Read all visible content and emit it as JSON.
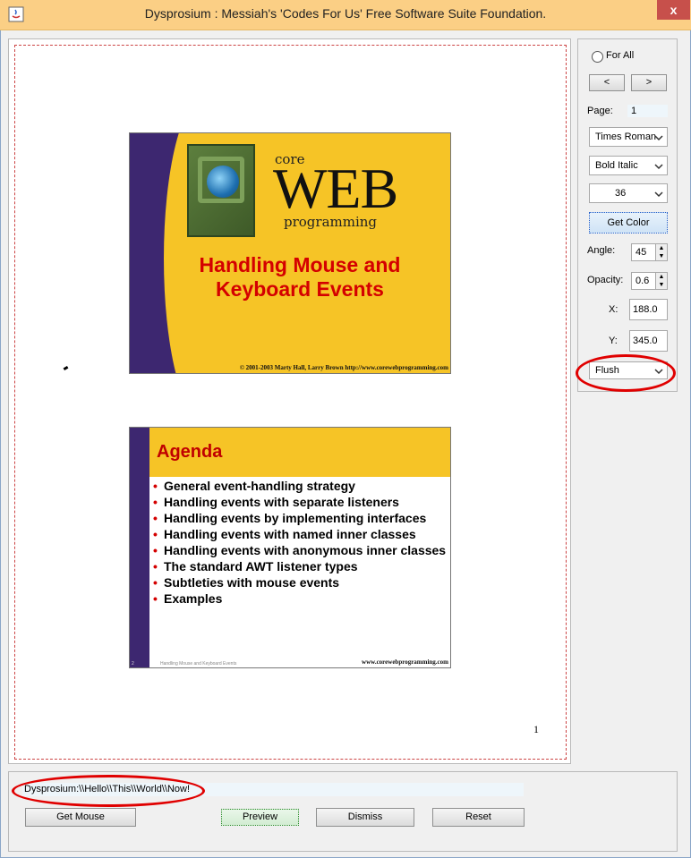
{
  "window": {
    "title": "Dysprosium : Messiah's 'Codes For Us' Free Software Suite Foundation.",
    "close_label": "x"
  },
  "preview": {
    "page_number": "1",
    "slide1": {
      "core": "core",
      "web": "WEB",
      "programming": "programming",
      "title_line1": "Handling Mouse and",
      "title_line2": "Keyboard Events",
      "footer": "© 2001-2003 Marty Hall, Larry Brown http://www.corewebprogramming.com"
    },
    "slide2": {
      "title": "Agenda",
      "bullets": [
        "General event-handling strategy",
        "Handling events with separate listeners",
        "Handling events by implementing interfaces",
        "Handling events with named inner classes",
        "Handling events with anonymous inner classes",
        "The standard AWT listener types",
        "Subtleties with mouse events",
        "Examples"
      ],
      "bullet_glyph": "•",
      "slide_num": "2",
      "footer_left": "Handling Mouse and Keyboard Events",
      "footer_right": "www.corewebprogramming.com"
    }
  },
  "controls": {
    "for_all_label": "For All",
    "prev_label": "<",
    "next_label": ">",
    "page_label": "Page:",
    "page_value": "1",
    "font_family": "Times Roman",
    "font_style": "Bold Italic",
    "font_size": "36",
    "get_color_label": "Get Color",
    "angle_label": "Angle:",
    "angle_value": "45",
    "opacity_label": "Opacity:",
    "opacity_value": "0.6",
    "x_label": "X:",
    "x_value": "188.0",
    "y_label": "Y:",
    "y_value": "345.0",
    "alignment": "Flush"
  },
  "bottom": {
    "text_value": "Dysprosium:\\\\Hello\\\\This\\\\World\\\\Now!",
    "get_mouse_label": "Get Mouse",
    "preview_label": "Preview",
    "dismiss_label": "Dismiss",
    "reset_label": "Reset"
  },
  "colors": {
    "highlight_ellipse": "#e00000",
    "slide_yellow": "#f6c426",
    "slide_purple": "#3d2770",
    "slide_title_red": "#d40000"
  }
}
